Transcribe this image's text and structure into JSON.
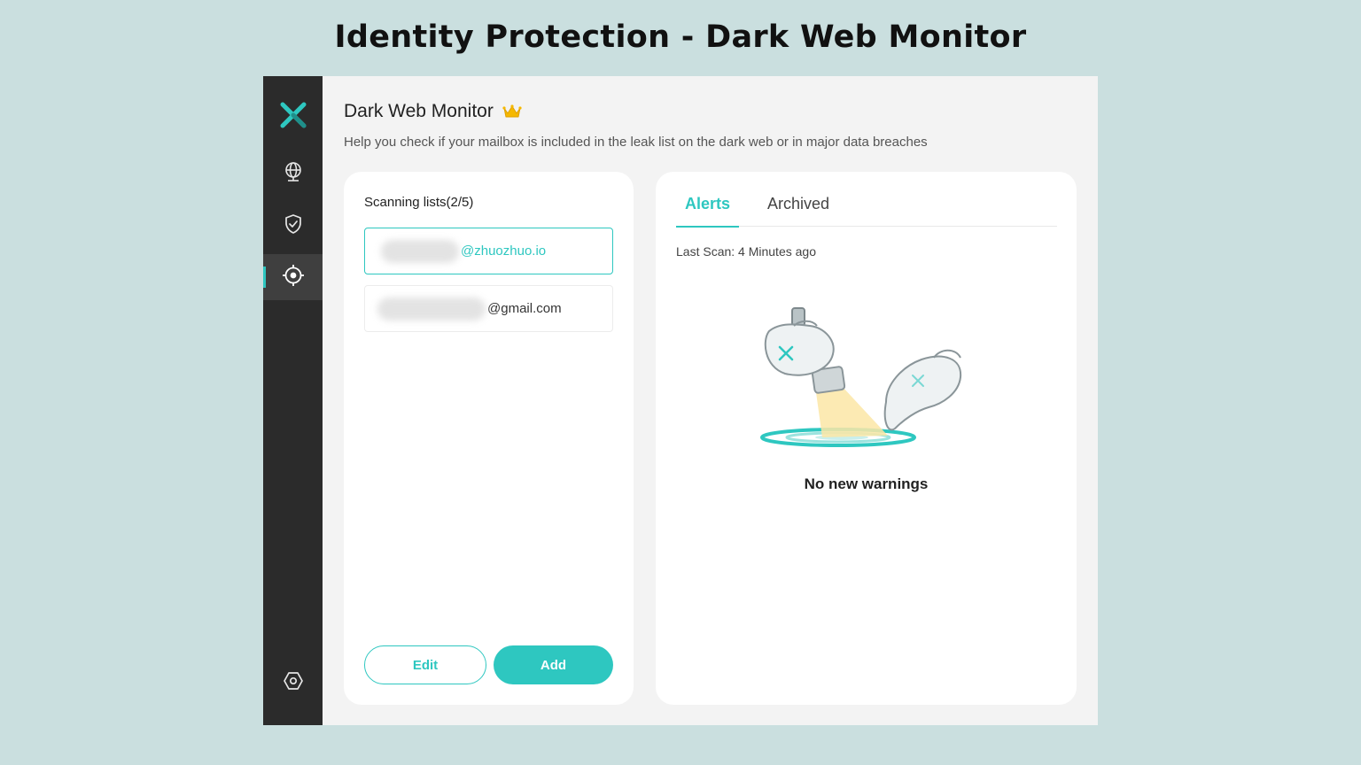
{
  "page": {
    "heading": "Identity Protection - Dark Web Monitor"
  },
  "colors": {
    "accent": "#2ec7c0",
    "sidebar_bg": "#2b2b2b",
    "crown": "#f5b800"
  },
  "sidebar": {
    "logo_icon": "x-logo-icon",
    "items": [
      {
        "icon": "globe-icon",
        "active": false
      },
      {
        "icon": "shield-check-icon",
        "active": false
      },
      {
        "icon": "target-icon",
        "active": true
      },
      {
        "icon": "settings-icon",
        "active": false
      }
    ]
  },
  "main": {
    "title": "Dark Web Monitor",
    "title_icon": "crown-icon",
    "subtitle": "Help you check if your mailbox is included in the leak list on the dark web or in major data breaches"
  },
  "scanning": {
    "title": "Scanning lists(2/5)",
    "emails": [
      {
        "domain": "@zhuozhuo.io",
        "selected": true
      },
      {
        "domain": "@gmail.com",
        "selected": false
      }
    ],
    "edit_label": "Edit",
    "add_label": "Add"
  },
  "alerts": {
    "tabs": [
      {
        "label": "Alerts",
        "active": true
      },
      {
        "label": "Archived",
        "active": false
      }
    ],
    "last_scan": "Last Scan: 4 Minutes ago",
    "empty_message": "No new warnings"
  }
}
